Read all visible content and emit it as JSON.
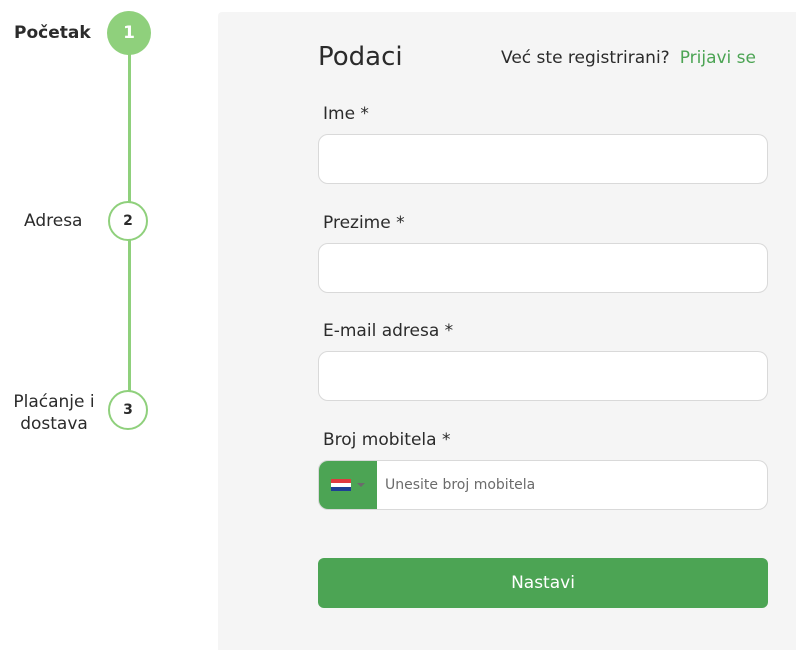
{
  "stepper": {
    "steps": [
      {
        "number": "1",
        "label": "Početak",
        "active": true
      },
      {
        "number": "2",
        "label": "Adresa",
        "active": false
      },
      {
        "number": "3",
        "label": "Plaćanje i dostava",
        "active": false
      }
    ]
  },
  "form": {
    "title": "Podaci",
    "login_prompt": "Već ste registrirani?",
    "login_link": "Prijavi se",
    "fields": [
      {
        "label": "Ime *",
        "value": ""
      },
      {
        "label": "Prezime *",
        "value": ""
      },
      {
        "label": "E-mail adresa *",
        "value": ""
      },
      {
        "label": "Broj mobitela *",
        "value": "",
        "placeholder": "Unesite broj mobitela"
      }
    ],
    "country_flag": "croatia-flag-icon",
    "submit_label": "Nastavi"
  },
  "colors": {
    "accent": "#4ca454",
    "step_accent": "#8fd07c",
    "panel_bg": "#f5f5f5"
  }
}
